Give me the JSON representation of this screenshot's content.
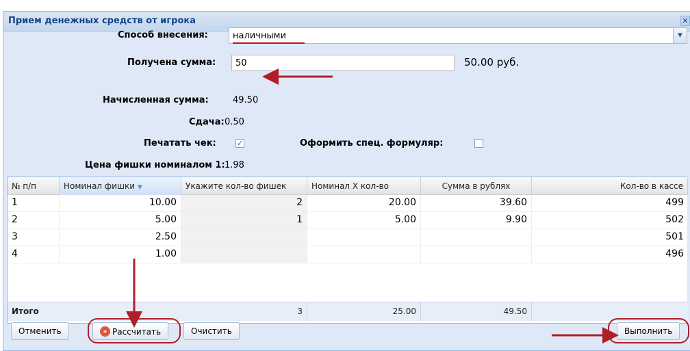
{
  "window": {
    "title": "Прием денежных средств от игрока"
  },
  "form": {
    "method_label": "Способ внесения:",
    "method_value": "наличными",
    "received_label": "Получена сумма:",
    "received_value": "50",
    "received_formatted": "50.00 руб.",
    "accrued_label": "Начисленная сумма:",
    "accrued_value": "49.50",
    "change_label": "Сдача:",
    "change_value": "0.50",
    "print_receipt_label": "Печатать чек:",
    "print_receipt_checked": true,
    "special_form_label": "Оформить спец. формуляр:",
    "special_form_checked": false,
    "chip_price_label": "Цена фишки номиналом 1:",
    "chip_price_value": "1.98"
  },
  "grid": {
    "columns": [
      "№ п/п",
      "Номинал фишки",
      "Укажите кол-во фишек",
      "Номинал Х кол-во",
      "Сумма в рублях",
      "Кол-во в кассе"
    ],
    "rows": [
      [
        "1",
        "10.00",
        "2",
        "20.00",
        "39.60",
        "499"
      ],
      [
        "2",
        "5.00",
        "1",
        "5.00",
        "9.90",
        "502"
      ],
      [
        "3",
        "2.50",
        "",
        "",
        "",
        "501"
      ],
      [
        "4",
        "1.00",
        "",
        "",
        "",
        "496"
      ]
    ],
    "summary": {
      "label": "Итого",
      "count": "3",
      "nominal_total": "25.00",
      "rub_total": "49.50"
    }
  },
  "buttons": {
    "cancel": "Отменить",
    "calculate": "Рассчитать",
    "clear": "Очистить",
    "execute": "Выполнить"
  },
  "colors": {
    "annotation": "#b01e26",
    "title": "#15428b"
  },
  "icons": [
    "close-icon",
    "chevron-down-icon",
    "checkbox-checked-icon",
    "checkbox-empty-icon",
    "sort-desc-icon",
    "calculate-icon"
  ]
}
